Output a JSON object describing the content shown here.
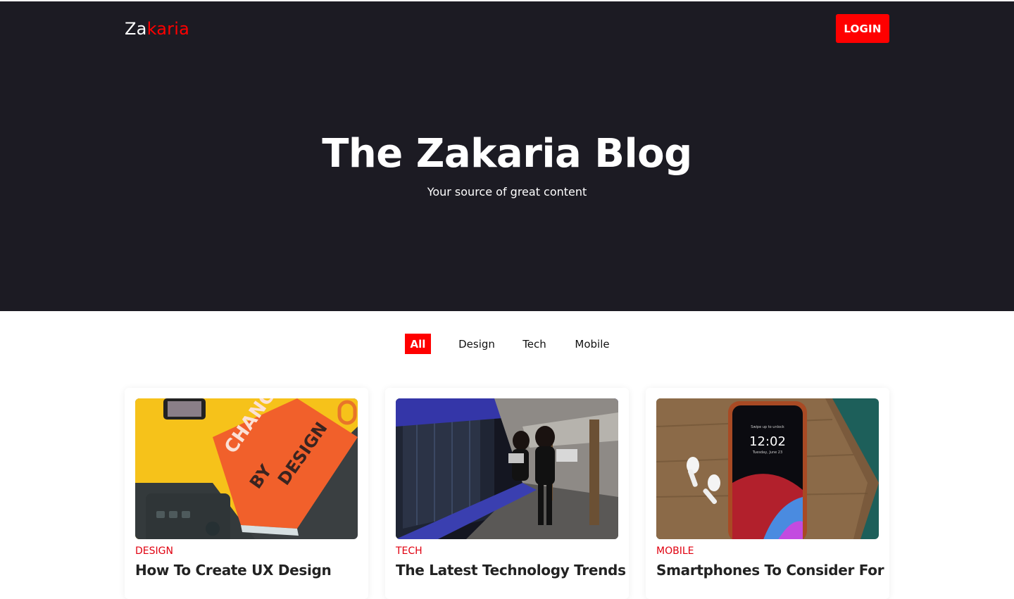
{
  "header": {
    "logo_part1": "Za",
    "logo_part2": "karia",
    "login_label": "LOGIN"
  },
  "hero": {
    "title": "The Zakaria Blog",
    "subtitle": "Your source of great content"
  },
  "filters": [
    {
      "label": "All",
      "active": true
    },
    {
      "label": "Design",
      "active": false
    },
    {
      "label": "Tech",
      "active": false
    },
    {
      "label": "Mobile",
      "active": false
    }
  ],
  "posts": [
    {
      "category": "DESIGN",
      "title": "How To Create UX Design",
      "image": "book-change-by-design"
    },
    {
      "category": "TECH",
      "title": "The Latest Technology Trends",
      "image": "women-in-server-room"
    },
    {
      "category": "MOBILE",
      "title": "Smartphones To Consider For",
      "image": "iphone-with-airpods"
    }
  ],
  "colors": {
    "accent": "#ff0000",
    "hero_bg": "#1c1b23",
    "category_text": "#e0000f"
  }
}
